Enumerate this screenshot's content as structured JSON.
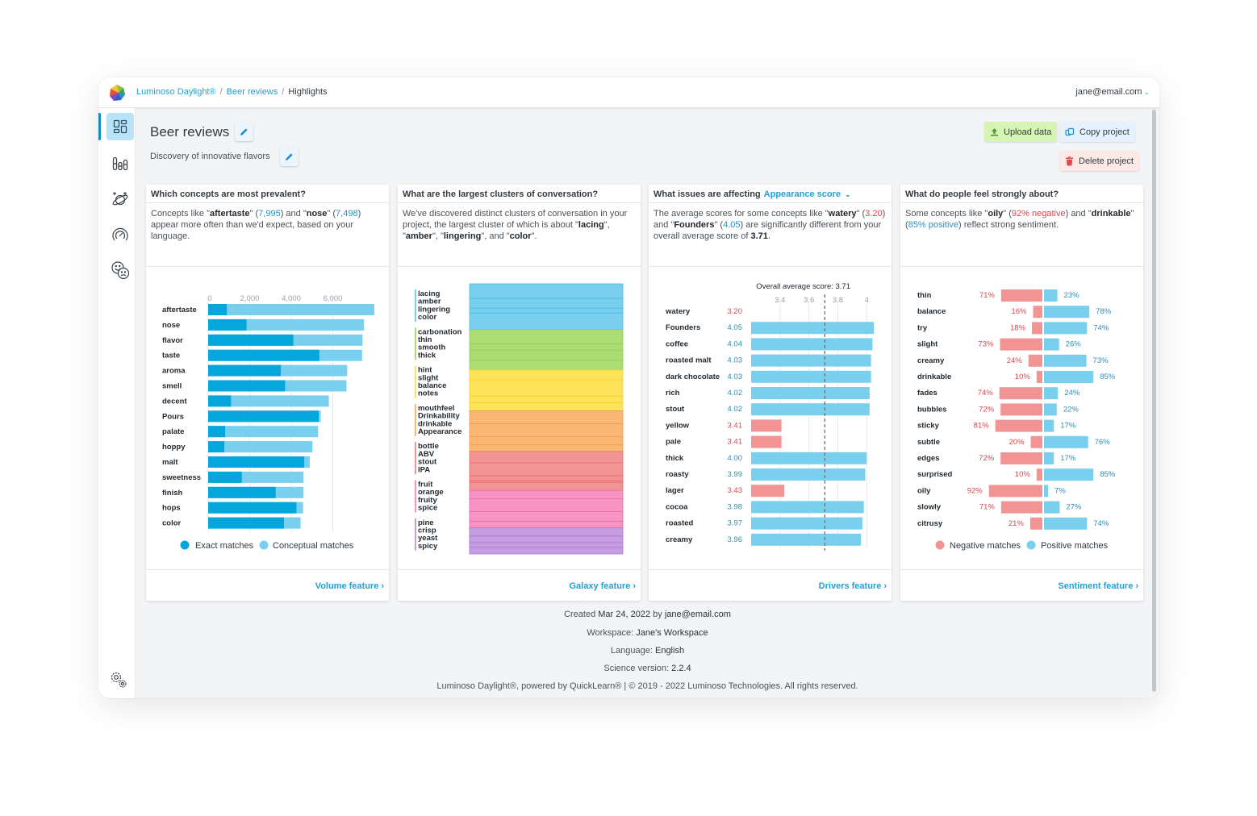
{
  "topbar": {
    "breadcrumbs": [
      {
        "label": "Luminoso Daylight®",
        "link": true
      },
      {
        "label": "Beer reviews",
        "link": true
      },
      {
        "label": "Highlights",
        "link": false
      }
    ],
    "separator": "/",
    "user": "jane@email.com",
    "user_chevron": "⌄"
  },
  "sidebar": {
    "items": [
      {
        "icon": "dashboard-icon",
        "active": true
      },
      {
        "icon": "volume-bars-icon",
        "active": false
      },
      {
        "icon": "galaxy-planet-icon",
        "active": false
      },
      {
        "icon": "drivers-gauge-icon",
        "active": false
      },
      {
        "icon": "sentiment-faces-icon",
        "active": false
      }
    ],
    "settings_icon": "settings-gears-icon"
  },
  "project": {
    "title": "Beer reviews",
    "description": "Discovery of innovative flavors",
    "buttons": {
      "upload": "Upload data",
      "copy": "Copy project",
      "delete": "Delete project"
    }
  },
  "colors": {
    "accent": "#1ea2d6",
    "exact": "#05a6dc",
    "conceptual": "#79d0ee",
    "positive": "#79d0ee",
    "negative": "#f39494",
    "positive_text": "#2f8fb8",
    "negative_text": "#d9474f"
  },
  "cards": {
    "volume": {
      "title": "Which concepts are most prevalent?",
      "desc": {
        "p1": "Concepts like \"",
        "term1": "aftertaste",
        "p2": "\" (",
        "val1": "7,995",
        "p3": ") and \"",
        "term2": "nose",
        "p4": "\" (",
        "val2": "7,498",
        "p5": ") appear more often than we'd expect, based on your language."
      },
      "footer_link": "Volume feature",
      "chev": "›"
    },
    "galaxy": {
      "title": "What are the largest clusters of conversation?",
      "desc": {
        "p1": "We've discovered distinct clusters of conversation in your project, the largest cluster of which is about \"",
        "t1": "lacing",
        "p2": "\", \"",
        "t2": "amber",
        "p3": "\", \"",
        "t3": "lingering",
        "p4": "\", and \"",
        "t4": "color",
        "p5": "\"."
      },
      "footer_link": "Galaxy feature",
      "chev": "›"
    },
    "drivers": {
      "title": "What issues are affecting",
      "score_selector": "Appearance score",
      "selector_chev": "⌄",
      "desc": {
        "p1": "The average scores for some concepts like \"",
        "t1": "watery",
        "p2": "\" (",
        "v1": "3.20",
        "p3": ") and \"",
        "t2": "Founders",
        "p4": "\" (",
        "v2": "4.05",
        "p5": ") are significantly different from your overall average score of ",
        "avg": "3.71",
        "p6": "."
      },
      "footer_link": "Drivers feature",
      "chev": "›"
    },
    "sentiment": {
      "title": "What do people feel strongly about?",
      "desc": {
        "p1": "Some concepts like \"",
        "t1": "oily",
        "p2": "\" (",
        "v1": "92% negative",
        "p3": ") and \"",
        "t2": "drinkable",
        "p4": "\" (",
        "v2": "85% positive",
        "p5": ") reflect strong sentiment."
      },
      "footer_link": "Sentiment feature",
      "chev": "›"
    }
  },
  "chart_data": [
    {
      "id": "volume",
      "type": "bar",
      "stacked": true,
      "orientation": "horizontal",
      "categories": [
        "aftertaste",
        "nose",
        "flavor",
        "taste",
        "aroma",
        "smell",
        "decent",
        "Pours",
        "palate",
        "hoppy",
        "malt",
        "sweetness",
        "finish",
        "hops",
        "color"
      ],
      "series": [
        {
          "name": "Exact matches",
          "values": [
            900,
            1850,
            4100,
            5350,
            3500,
            3700,
            1100,
            5320,
            820,
            780,
            4620,
            1620,
            3250,
            4250,
            3650
          ]
        },
        {
          "name": "Total (incl. conceptual matches)",
          "values": [
            7995,
            7498,
            7430,
            7410,
            6690,
            6660,
            5810,
            5420,
            5290,
            5020,
            4890,
            4590,
            4590,
            4570,
            4450
          ]
        }
      ],
      "xticks": [
        "0",
        "2,000",
        "4,000",
        "6,000"
      ],
      "xtick_values": [
        0,
        2000,
        4000,
        6000
      ],
      "xlim": [
        0,
        8000
      ],
      "legend": [
        {
          "name": "Exact matches"
        },
        {
          "name": "Conceptual matches"
        }
      ],
      "legend_position": "bottom",
      "grid": true
    },
    {
      "id": "galaxy",
      "type": "bar",
      "stacked": true,
      "orientation": "vertical-stack",
      "clusters": [
        {
          "terms": [
            "lacing",
            "amber",
            "lingering",
            "color"
          ],
          "color": "#79d0ee",
          "line": "#4bbde4",
          "segments": [
            9,
            6,
            3,
            10
          ]
        },
        {
          "terms": [
            "carbonation",
            "thin",
            "smooth",
            "thick"
          ],
          "color": "#acdc72",
          "line": "#96cc5c",
          "segments": [
            9,
            4,
            6,
            6
          ]
        },
        {
          "terms": [
            "hint",
            "slight",
            "balance",
            "notes"
          ],
          "color": "#fde35a",
          "line": "#f4d12c",
          "segments": [
            6,
            10,
            4,
            5
          ]
        },
        {
          "terms": [
            "mouthfeel",
            "Drinkability",
            "drinkable",
            "Appearance"
          ],
          "color": "#f9b773",
          "line": "#f39a4a",
          "segments": [
            8,
            8,
            5,
            4
          ]
        },
        {
          "terms": [
            "bottle",
            "ABV",
            "stout",
            "IPA"
          ],
          "color": "#f39494",
          "line": "#e96b6f",
          "segments": [
            7,
            8,
            3,
            1,
            5
          ]
        },
        {
          "terms": [
            "fruit",
            "orange",
            "fruity",
            "spice"
          ],
          "color": "#f794c4",
          "line": "#ec6aa5",
          "segments": [
            5,
            8,
            6,
            4
          ]
        },
        {
          "terms": [
            "pine",
            "crisp",
            "yeast",
            "spicy"
          ],
          "color": "#c59de0",
          "line": "#a978d2",
          "segments": [
            5,
            4,
            3,
            4
          ]
        }
      ]
    },
    {
      "id": "drivers",
      "type": "bar",
      "orientation": "horizontal",
      "annotation": "Overall average score: 3.71",
      "average": 3.71,
      "categories": [
        "watery",
        "Founders",
        "coffee",
        "roasted malt",
        "dark chocolate",
        "rich",
        "stout",
        "yellow",
        "pale",
        "thick",
        "roasty",
        "lager",
        "cocoa",
        "roasted",
        "creamy"
      ],
      "values": [
        3.2,
        4.05,
        4.04,
        4.03,
        4.03,
        4.02,
        4.02,
        3.41,
        3.41,
        4.0,
        3.99,
        3.43,
        3.98,
        3.97,
        3.96
      ],
      "value_labels": [
        "3.20",
        "4.05",
        "4.04",
        "4.03",
        "4.03",
        "4.02",
        "4.02",
        "3.41",
        "3.41",
        "4.00",
        "3.99",
        "3.43",
        "3.98",
        "3.97",
        "3.96"
      ],
      "xticks": [
        "3.4",
        "3.6",
        "3.8",
        "4"
      ],
      "xtick_values": [
        3.4,
        3.6,
        3.8,
        4.0
      ],
      "xlim": [
        3.2,
        4.06
      ],
      "grid": true
    },
    {
      "id": "sentiment",
      "type": "bar",
      "orientation": "diverging",
      "categories": [
        "thin",
        "balance",
        "try",
        "slight",
        "creamy",
        "drinkable",
        "fades",
        "bubbles",
        "sticky",
        "subtle",
        "edges",
        "surprised",
        "oily",
        "slowly",
        "citrusy"
      ],
      "series": [
        {
          "name": "Negative matches",
          "values": [
            71,
            16,
            18,
            73,
            24,
            10,
            74,
            72,
            81,
            20,
            72,
            10,
            92,
            71,
            21
          ]
        },
        {
          "name": "Positive matches",
          "values": [
            23,
            78,
            74,
            26,
            73,
            85,
            24,
            22,
            17,
            76,
            17,
            85,
            7,
            27,
            74
          ]
        }
      ],
      "unit": "%",
      "legend": [
        {
          "name": "Negative matches"
        },
        {
          "name": "Positive matches"
        }
      ],
      "legend_position": "bottom"
    }
  ],
  "footer": {
    "created_prefix": "Created ",
    "created_date": "Mar 24, 2022",
    "created_by_prefix": " by ",
    "created_by": "jane@email.com",
    "workspace_label": "Workspace: ",
    "workspace": "Jane's Workspace",
    "language_label": "Language: ",
    "language": "English",
    "science_label": "Science version: ",
    "science_version": "2.2.4",
    "copyright": "Luminoso Daylight®, powered by QuickLearn® | © 2019 - 2022 Luminoso Technologies. All rights reserved."
  }
}
